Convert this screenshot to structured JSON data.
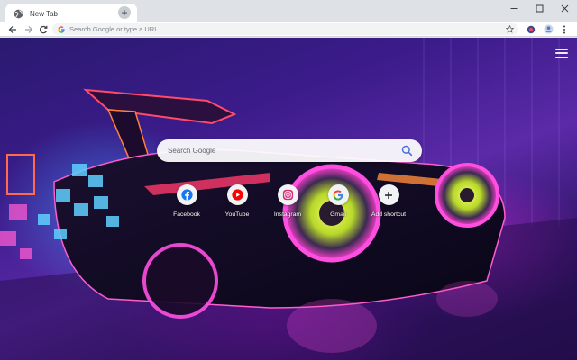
{
  "browser": {
    "tab": {
      "title": "New Tab",
      "close_glyph": "✕"
    },
    "new_tab_glyph": "+",
    "window_controls": {
      "minimize_icon": "minimize-icon",
      "maximize_icon": "maximize-icon",
      "close_icon": "close-icon"
    },
    "toolbar": {
      "back_icon": "back-arrow-icon",
      "forward_icon": "forward-arrow-icon",
      "reload_icon": "reload-icon",
      "omnibox": {
        "value": "",
        "placeholder": "Search Google or type a URL"
      },
      "bookmark_icon": "star-icon",
      "extension_icon": "extension-icon",
      "profile_icon": "avatar-icon",
      "menu_icon": "kebab-menu-icon"
    }
  },
  "ntp": {
    "search": {
      "value": "",
      "placeholder": "Search Google"
    },
    "menu_icon": "hamburger-icon",
    "shortcuts": [
      {
        "label": "Facebook",
        "icon": "facebook-icon",
        "color": "#1877f2"
      },
      {
        "label": "YouTube",
        "icon": "youtube-icon",
        "color": "#ff0000"
      },
      {
        "label": "Instagram",
        "icon": "instagram-icon",
        "color": "#d62976"
      },
      {
        "label": "Gmail",
        "icon": "google-icon",
        "color": "#4285f4"
      },
      {
        "label": "Add shortcut",
        "icon": "plus-icon",
        "color": "#202124"
      }
    ]
  },
  "colors": {
    "tabstrip": "#dee1e6",
    "toolbar": "#ffffff",
    "omnibox": "#f1f3f4"
  }
}
